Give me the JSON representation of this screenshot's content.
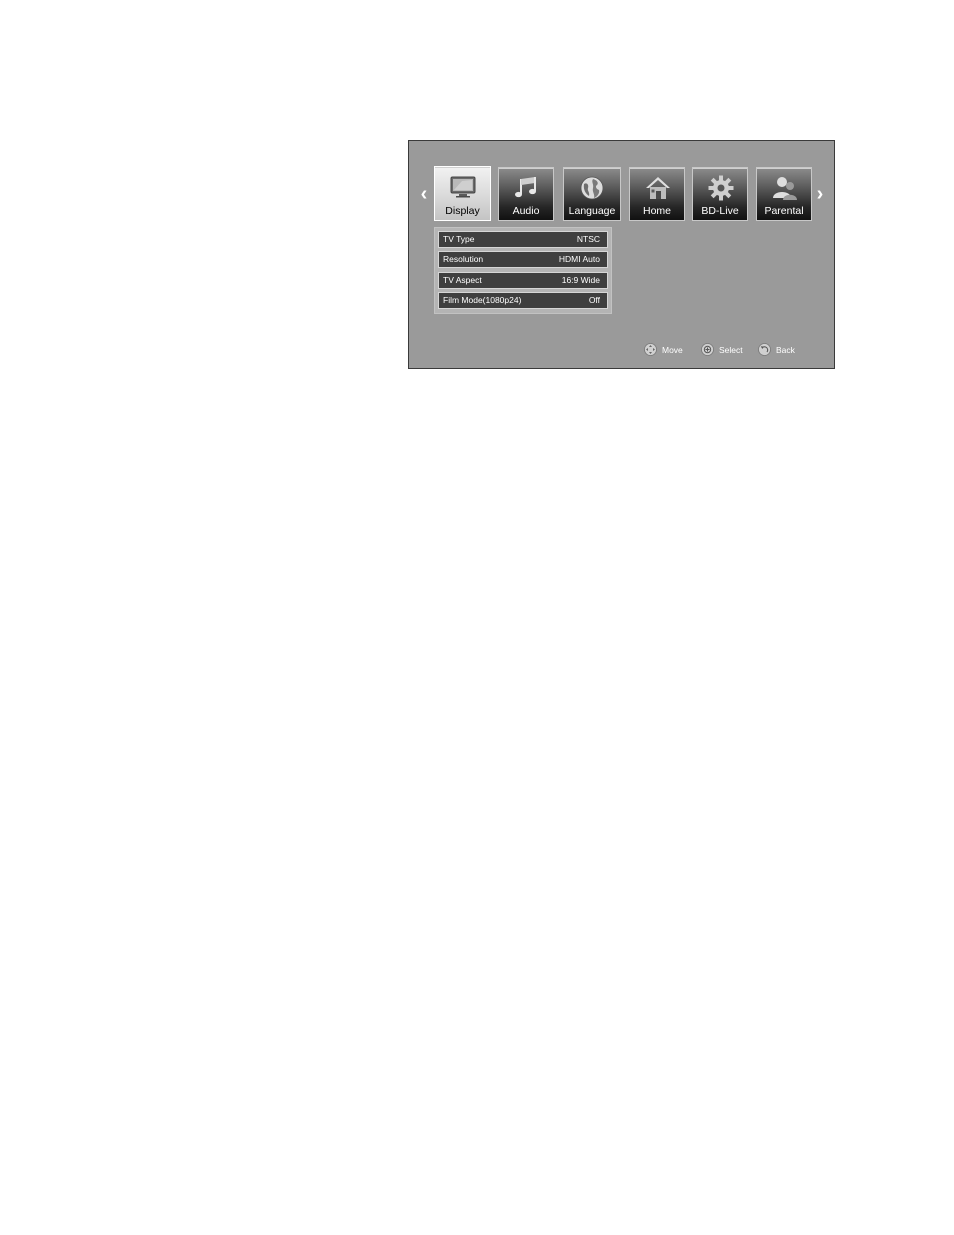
{
  "menu": {
    "arrow_left": "‹",
    "arrow_right": "›",
    "tabs": [
      {
        "label": "Display",
        "icon": "tv-icon",
        "active": true
      },
      {
        "label": "Audio",
        "icon": "music-note-icon",
        "active": false
      },
      {
        "label": "Language",
        "icon": "globe-icon",
        "active": false
      },
      {
        "label": "Home",
        "icon": "house-icon",
        "active": false
      },
      {
        "label": "BD-Live",
        "icon": "gear-icon",
        "active": false
      },
      {
        "label": "Parental",
        "icon": "users-icon",
        "active": false
      }
    ]
  },
  "settings": [
    {
      "name": "TV Type",
      "value": "NTSC"
    },
    {
      "name": "Resolution",
      "value": "HDMI Auto"
    },
    {
      "name": "TV Aspect",
      "value": "16:9 Wide"
    },
    {
      "name": "Film Mode(1080p24)",
      "value": "Off"
    }
  ],
  "hints": {
    "move": {
      "label": "Move",
      "icon": "dpad-icon"
    },
    "select": {
      "label": "Select",
      "icon": "enter-icon"
    },
    "back": {
      "label": "Back",
      "icon": "back-icon"
    }
  },
  "colors": {
    "screen_background": "#9a9a9a",
    "row_background": "#3f3f3f",
    "active_tab": "#dcdcdc"
  }
}
